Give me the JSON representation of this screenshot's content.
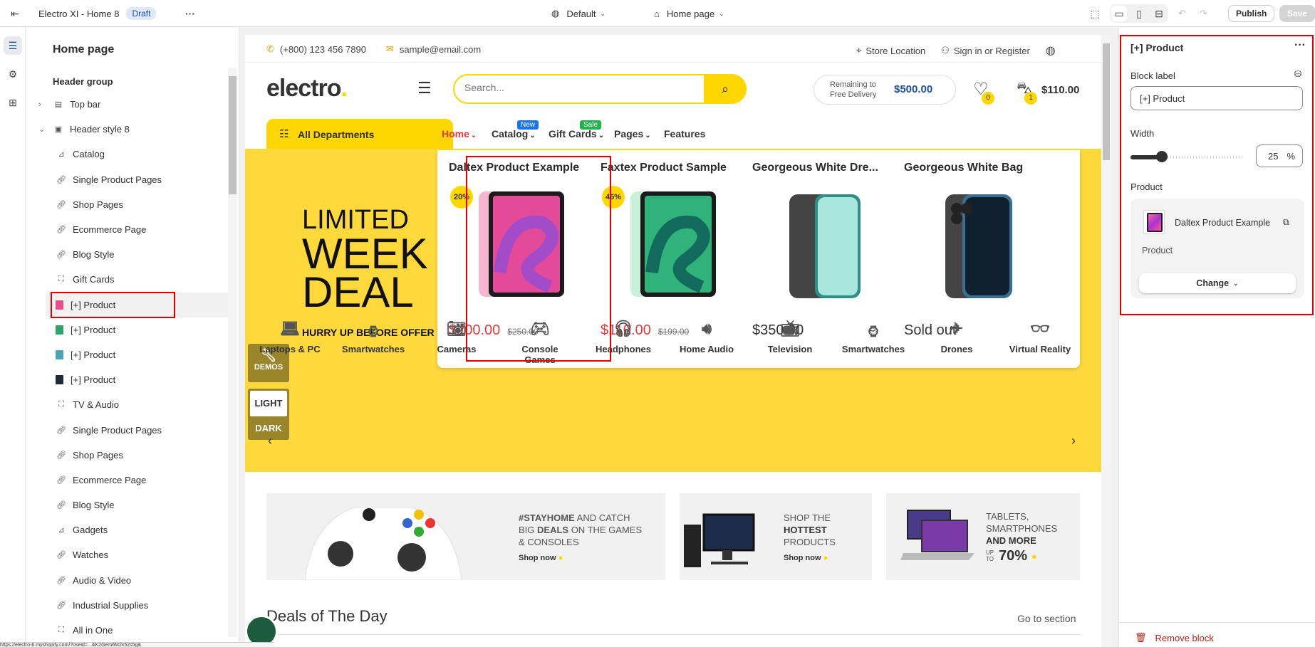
{
  "topbar": {
    "store_name": "Electro XI - Home 8",
    "draft_badge": "Draft",
    "theme_select": "Default",
    "page_select": "Home page",
    "publish_label": "Publish",
    "save_label": "Save"
  },
  "sidebar": {
    "title": "Home page",
    "group_label": "Header group",
    "items": [
      {
        "label": "Top bar",
        "icon": "layout-icon",
        "level": 1
      },
      {
        "label": "Header style 8",
        "icon": "header-icon",
        "level": 1
      },
      {
        "label": "Catalog",
        "icon": "image-icon",
        "level": 2
      },
      {
        "label": "Single Product Pages",
        "icon": "link-icon",
        "level": 2
      },
      {
        "label": "Shop Pages",
        "icon": "link-icon",
        "level": 2
      },
      {
        "label": "Ecommerce Page",
        "icon": "link-icon",
        "level": 2
      },
      {
        "label": "Blog Style",
        "icon": "link-icon",
        "level": 2
      },
      {
        "label": "Gift Cards",
        "icon": "frame-icon",
        "level": 2
      },
      {
        "label": "[+] Product",
        "icon": "product-thumb",
        "level": 2,
        "selected": true
      },
      {
        "label": "[+] Product",
        "icon": "product-thumb",
        "level": 2
      },
      {
        "label": "[+] Product",
        "icon": "product-thumb",
        "level": 2
      },
      {
        "label": "[+] Product",
        "icon": "product-thumb",
        "level": 2
      },
      {
        "label": "TV & Audio",
        "icon": "frame-icon",
        "level": 2
      },
      {
        "label": "Single Product Pages",
        "icon": "link-icon",
        "level": 2
      },
      {
        "label": "Shop Pages",
        "icon": "link-icon",
        "level": 2
      },
      {
        "label": "Ecommerce Page",
        "icon": "link-icon",
        "level": 2
      },
      {
        "label": "Blog Style",
        "icon": "link-icon",
        "level": 2
      },
      {
        "label": "Gadgets",
        "icon": "image-icon",
        "level": 2
      },
      {
        "label": "Watches",
        "icon": "link-icon",
        "level": 2
      },
      {
        "label": "Audio & Video",
        "icon": "link-icon",
        "level": 2
      },
      {
        "label": "Industrial Supplies",
        "icon": "link-icon",
        "level": 2
      },
      {
        "label": "All in One",
        "icon": "frame-icon",
        "level": 2
      }
    ]
  },
  "store": {
    "phone": "(+800) 123 456 7890",
    "email": "sample@email.com",
    "store_location": "Store Location",
    "sign_in": "Sign in or Register",
    "logo": "electro",
    "search_placeholder": "Search...",
    "delivery_label_1": "Remaining to",
    "delivery_label_2": "Free Delivery",
    "delivery_amount": "$500.00",
    "wishlist_count": "0",
    "cart_count": "1",
    "cart_total": "$110.00",
    "all_departments": "All Departments",
    "nav": [
      {
        "label": "Home",
        "active": true,
        "dropdown": true
      },
      {
        "label": "Catalog",
        "tag": "New",
        "tag_color": "#1a73e8",
        "dropdown": true
      },
      {
        "label": "Gift Cards",
        "tag": "Sale",
        "tag_color": "#22b14c",
        "dropdown": true
      },
      {
        "label": "Pages",
        "dropdown": true
      },
      {
        "label": "Features"
      }
    ],
    "promo": {
      "line1": "LIMITED",
      "line2": "WEEK",
      "line3": "DEAL",
      "sub": "HURRY UP BEFORE OFFER WILL"
    },
    "products": [
      {
        "title": "Daltex Product Example",
        "discount": "20%",
        "price": "$200.00",
        "old_price": "$250.00",
        "sale": true
      },
      {
        "title": "Faxtex Product Sample",
        "discount": "45%",
        "price": "$110.00",
        "old_price": "$199.00",
        "sale": true
      },
      {
        "title": "Georgeous White Dre...",
        "discount": "",
        "price": "$350.00",
        "old_price": "",
        "sale": false
      },
      {
        "title": "Georgeous White Bag",
        "discount": "",
        "price": "Sold out",
        "old_price": "",
        "sale": false
      }
    ],
    "demos_label": "DEMOS",
    "light_label": "LIGHT",
    "dark_label": "DARK",
    "categories": [
      "Laptops & PC",
      "Smartwatches",
      "Cameras",
      "Console Games",
      "Headphones",
      "Home Audio",
      "Television",
      "Smartwatches",
      "Drones",
      "Virtual Reality"
    ],
    "banners": [
      {
        "line1_bold": "#STAYHOME",
        "line1_rest": " AND CATCH",
        "line2_pre": "BIG ",
        "line2_bold": "DEALS",
        "line2_rest": " ON THE GAMES",
        "line3": "& CONSOLES",
        "cta": "Shop now"
      },
      {
        "line1": "SHOP THE",
        "line2": "HOTTEST",
        "line3": "PRODUCTS",
        "cta": "Shop now"
      },
      {
        "line1": "TABLETS,",
        "line2": "SMARTPHONES",
        "line3": "AND MORE",
        "pct_pre": "UP TO",
        "pct": "70%"
      }
    ],
    "deals_title": "Deals of The Day",
    "go_to_section": "Go to section",
    "status_url": "https://electro-6.myshopify.com/?oseid=...&K2Gem6M2x52s5g&"
  },
  "panel": {
    "title": "[+] Product",
    "block_label_label": "Block label",
    "block_label_value": "[+] Product",
    "width_label": "Width",
    "width_value": "25",
    "width_fraction": 0.25,
    "width_unit": "%",
    "product_label": "Product",
    "product_name": "Daltex Product Example",
    "product_type": "Product",
    "change_label": "Change",
    "remove_label": "Remove block"
  },
  "colors": {
    "accent": "#fed700",
    "sale_red": "#e63b3b",
    "brand_blue": "#1f5199",
    "highlight": "#e00000"
  }
}
